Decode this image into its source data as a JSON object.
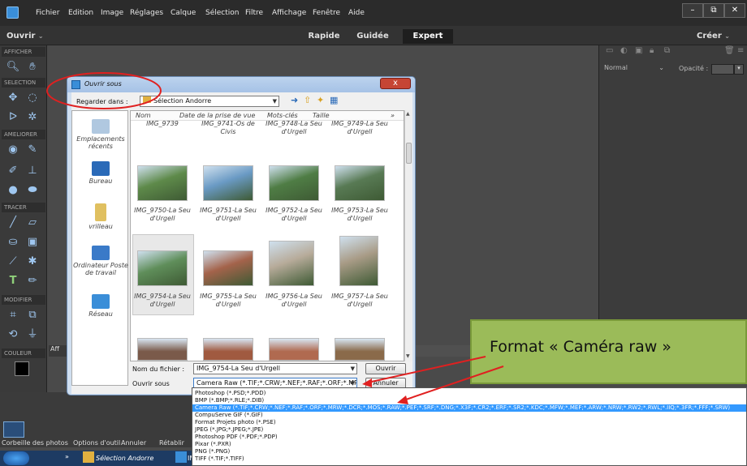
{
  "menu": [
    "Fichier",
    "Edition",
    "Image",
    "Réglages",
    "Calque",
    "Sélection",
    "Filtre",
    "Affichage",
    "Fenêtre",
    "Aide"
  ],
  "window_controls": [
    "–",
    "⧉",
    "✕"
  ],
  "modebar": {
    "open_label": "Ouvrir",
    "modes": [
      "Rapide",
      "Guidée",
      "Expert"
    ],
    "create_label": "Créer"
  },
  "toolbox": {
    "sections": [
      "AFFICHER",
      "SELECTION",
      "AMELIORER",
      "TRACER",
      "MODIFIER",
      "COULEUR"
    ],
    "color": "#3a8ed8"
  },
  "layers": {
    "blend_mode": "Normal",
    "opacity_label": "Opacité :"
  },
  "bottom": {
    "labels": [
      "Corbeille des photos",
      "Options d'outil",
      "Annuler",
      "Rétablir"
    ],
    "hidden_tab": "Aff"
  },
  "taskbar": {
    "items": [
      "Sélection Andorre",
      "IM"
    ]
  },
  "dialog": {
    "title": "Ouvrir sous",
    "close": "x",
    "look_in_label": "Regarder dans :",
    "look_in_value": "Sélection Andorre",
    "places": [
      "Emplacements récents",
      "Bureau",
      "vrilleau",
      "Ordinateur Poste de travail",
      "Réseau"
    ],
    "columns": [
      "Nom",
      "Date de la prise de vue",
      "Mots-clés",
      "Taille"
    ],
    "top_row": [
      "IMG_9739",
      "IMG_9741-Os de Civis",
      "IMG_9748-La Seu d'Urgell",
      "IMG_9749-La Seu d'Urgell"
    ],
    "thumbnails": [
      {
        "caption": "IMG_9750-La Seu d'Urgell",
        "color": "#5e8a4a"
      },
      {
        "caption": "IMG_9751-La Seu d'Urgell",
        "color": "#6a9ac4"
      },
      {
        "caption": "IMG_9752-La Seu d'Urgell",
        "color": "#4f7d45"
      },
      {
        "caption": "IMG_9753-La Seu d'Urgell",
        "color": "#587a54"
      },
      {
        "caption": "IMG_9754-La Seu d'Urgell",
        "color": "#5f8e5a"
      },
      {
        "caption": "IMG_9755-La Seu d'Urgell",
        "color": "#a4634b"
      },
      {
        "caption": "IMG_9756-La Seu d'Urgell",
        "color": "#b7ab9a"
      },
      {
        "caption": "IMG_9757-La Seu d'Urgell",
        "color": "#a89b86"
      }
    ],
    "bottom_row_colors": [
      "#7a5a4a",
      "#a05a40",
      "#b06a50",
      "#8a6a4a"
    ],
    "filename_label": "Nom du fichier :",
    "filename_value": "IMG_9754-La Seu d'Urgell",
    "open_as_label": "Ouvrir sous",
    "open_as_value": "Camera Raw (*.TIF;*.CRW;*.NEF;*.RAF;*.ORF;*.MRW",
    "ok_button": "Ouvrir",
    "cancel_button": "Annuler"
  },
  "file_types": [
    "Photoshop (*.PSD;*.PDD)",
    "BMP (*.BMP;*.RLE;*.DIB)",
    "Camera Raw (*.TIF;*.CRW;*.NEF;*.RAF;*.ORF;*.MRW;*.DCR;*.MOS;*.RAW;*.PEF;*.SRF;*.DNG;*.X3F;*.CR2;*.ERF;*.SR2;*.KDC;*.MFW;*.MEF;*.ARW;*.NRW;*.RW2;*.RWL;*.IIQ;*.3FR;*.FFF;*.SRW)",
    "CompuServe GIF (*.GIF)",
    "Format Projets photo (*.PSE)",
    "JPEG (*.JPG;*.JPEG;*.JPE)",
    "Photoshop PDF (*.PDF;*.PDP)",
    "Pixar (*.PXR)",
    "PNG (*.PNG)",
    "TIFF (*.TIF;*.TIFF)"
  ],
  "selected_file_type_index": 2,
  "callout": {
    "text": "Format « Caméra raw »",
    "color": "#9bbb59"
  }
}
